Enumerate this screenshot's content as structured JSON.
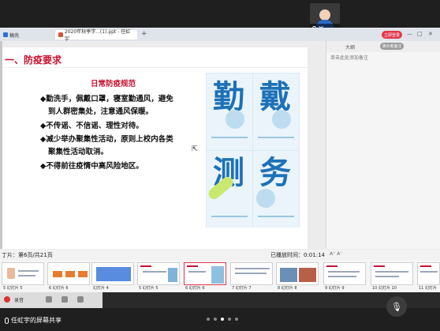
{
  "meeting": {
    "self_name": "任...",
    "share_label": "任虹宇的屏幕共享",
    "page_dots": 5,
    "active_dot": 2
  },
  "browser": {
    "tabs": [
      {
        "label": "稿壳"
      },
      {
        "label": "2020年秋季学...(1).ppt - 任虹宇"
      }
    ],
    "new_tab": "+",
    "login_label": "立即登录",
    "window_controls": [
      "—",
      "□",
      "✕"
    ]
  },
  "slide": {
    "title": "一、防疫要求",
    "subheading": "日常防疫规范",
    "rules": [
      "◆勤洗手，佩戴口罩，寝室勤通风，避免",
      "到人群密集处，注意通风保暖。",
      "◆不传谣、不信谣、理性对待。",
      "◆减少举办聚集性活动，原则上校内各类",
      "聚集性活动取消。",
      "◆不得前往疫情中高风险地区。"
    ],
    "poster_chars": [
      "勤",
      "戴",
      "测",
      "务"
    ]
  },
  "notes_panel": {
    "header": "大纲",
    "pill": "演示者备注",
    "placeholder": "单击此处添加备注"
  },
  "status": {
    "left": "丁片：第6页/共21页",
    "right": "已播放时间：0:01:14",
    "zoom": "A⁺  A⁻"
  },
  "thumbnails": [
    {
      "label": "5 幻灯片 5"
    },
    {
      "label": "6 幻灯片 6"
    },
    {
      "label": "幻灯片 4"
    },
    {
      "label": "5 幻灯片 5"
    },
    {
      "label": "6 幻灯片 6"
    },
    {
      "label": "7 幻灯片 7"
    },
    {
      "label": "8 幻灯片 8"
    },
    {
      "label": "9 幻灯片 9"
    },
    {
      "label": "10 幻灯片 10"
    },
    {
      "label": "11 幻灯片"
    }
  ],
  "taskstrip": {
    "label": "录音"
  },
  "colors": {
    "accent_red": "#c8102e",
    "poster_blue": "#1d71b8"
  }
}
